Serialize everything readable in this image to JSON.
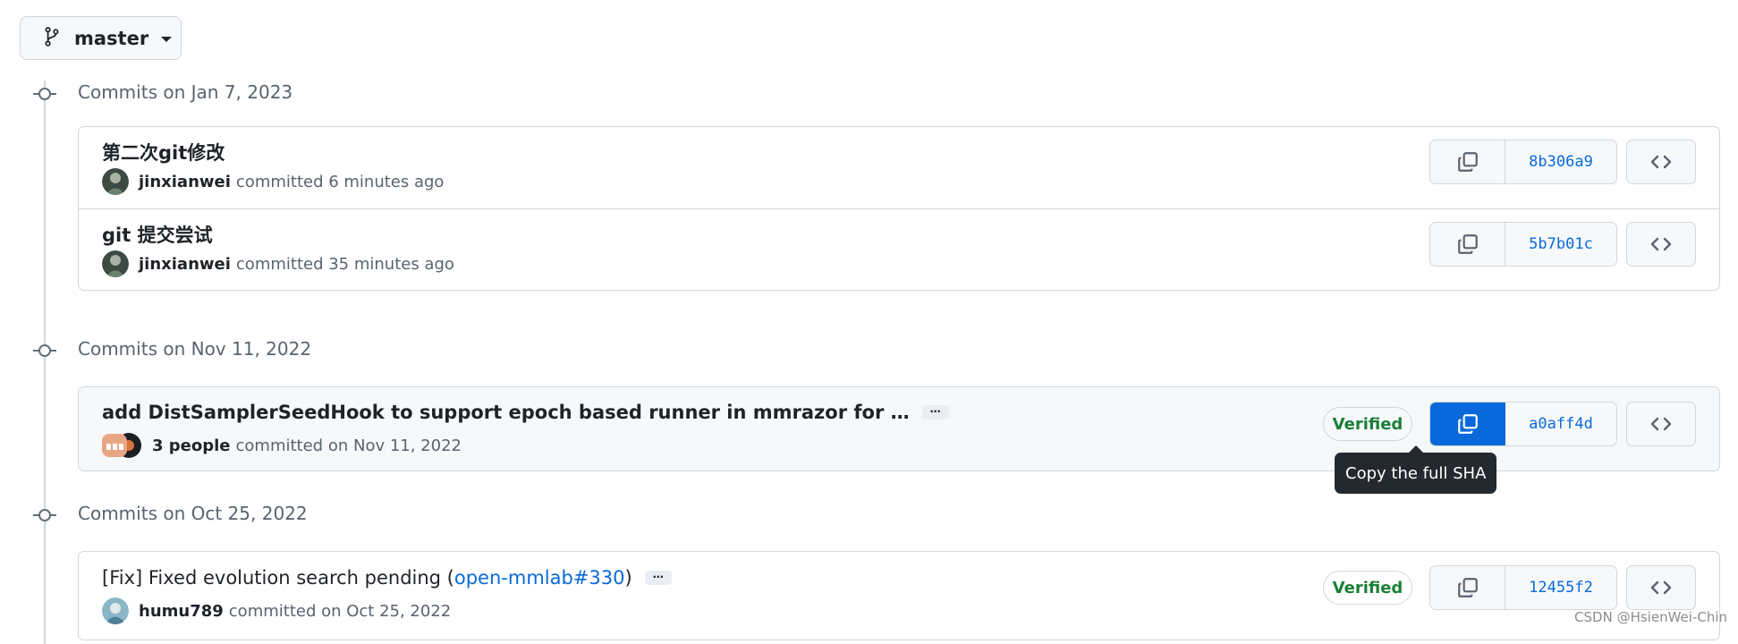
{
  "branch": {
    "name": "master",
    "icon": "git-branch-icon"
  },
  "groups": [
    {
      "date_label": "Commits on Jan 7, 2023",
      "commits": [
        {
          "message": "第二次git修改",
          "author": "jinxianwei",
          "committed": "committed 6 minutes ago",
          "sha": "8b306a9"
        },
        {
          "message": "git 提交尝试",
          "author": "jinxianwei",
          "committed": "committed 35 minutes ago",
          "sha": "5b7b01c"
        }
      ]
    },
    {
      "date_label": "Commits on Nov 11, 2022",
      "commits": [
        {
          "message": "add DistSamplerSeedHook to support epoch based runner in mmrazor for …",
          "ellipsis": "…",
          "author": "3 people",
          "committed": "committed on Nov 11, 2022",
          "verified": "Verified",
          "sha": "a0aff4d"
        }
      ]
    },
    {
      "date_label": "Commits on Oct 25, 2022",
      "commits": [
        {
          "message_prefix": "[Fix] Fixed evolution search pending (",
          "message_link": "open-mmlab#330",
          "message_suffix": ")",
          "ellipsis": "…",
          "author": "humu789",
          "committed": "committed on Oct 25, 2022",
          "verified": "Verified",
          "sha": "12455f2"
        }
      ]
    }
  ],
  "tooltip": "Copy the full SHA",
  "watermark": "CSDN @HsienWei-Chin",
  "colors": {
    "accent": "#0969da",
    "verified": "#1a7f37",
    "tooltip_bg": "#24292f",
    "border": "#d0d7de"
  }
}
